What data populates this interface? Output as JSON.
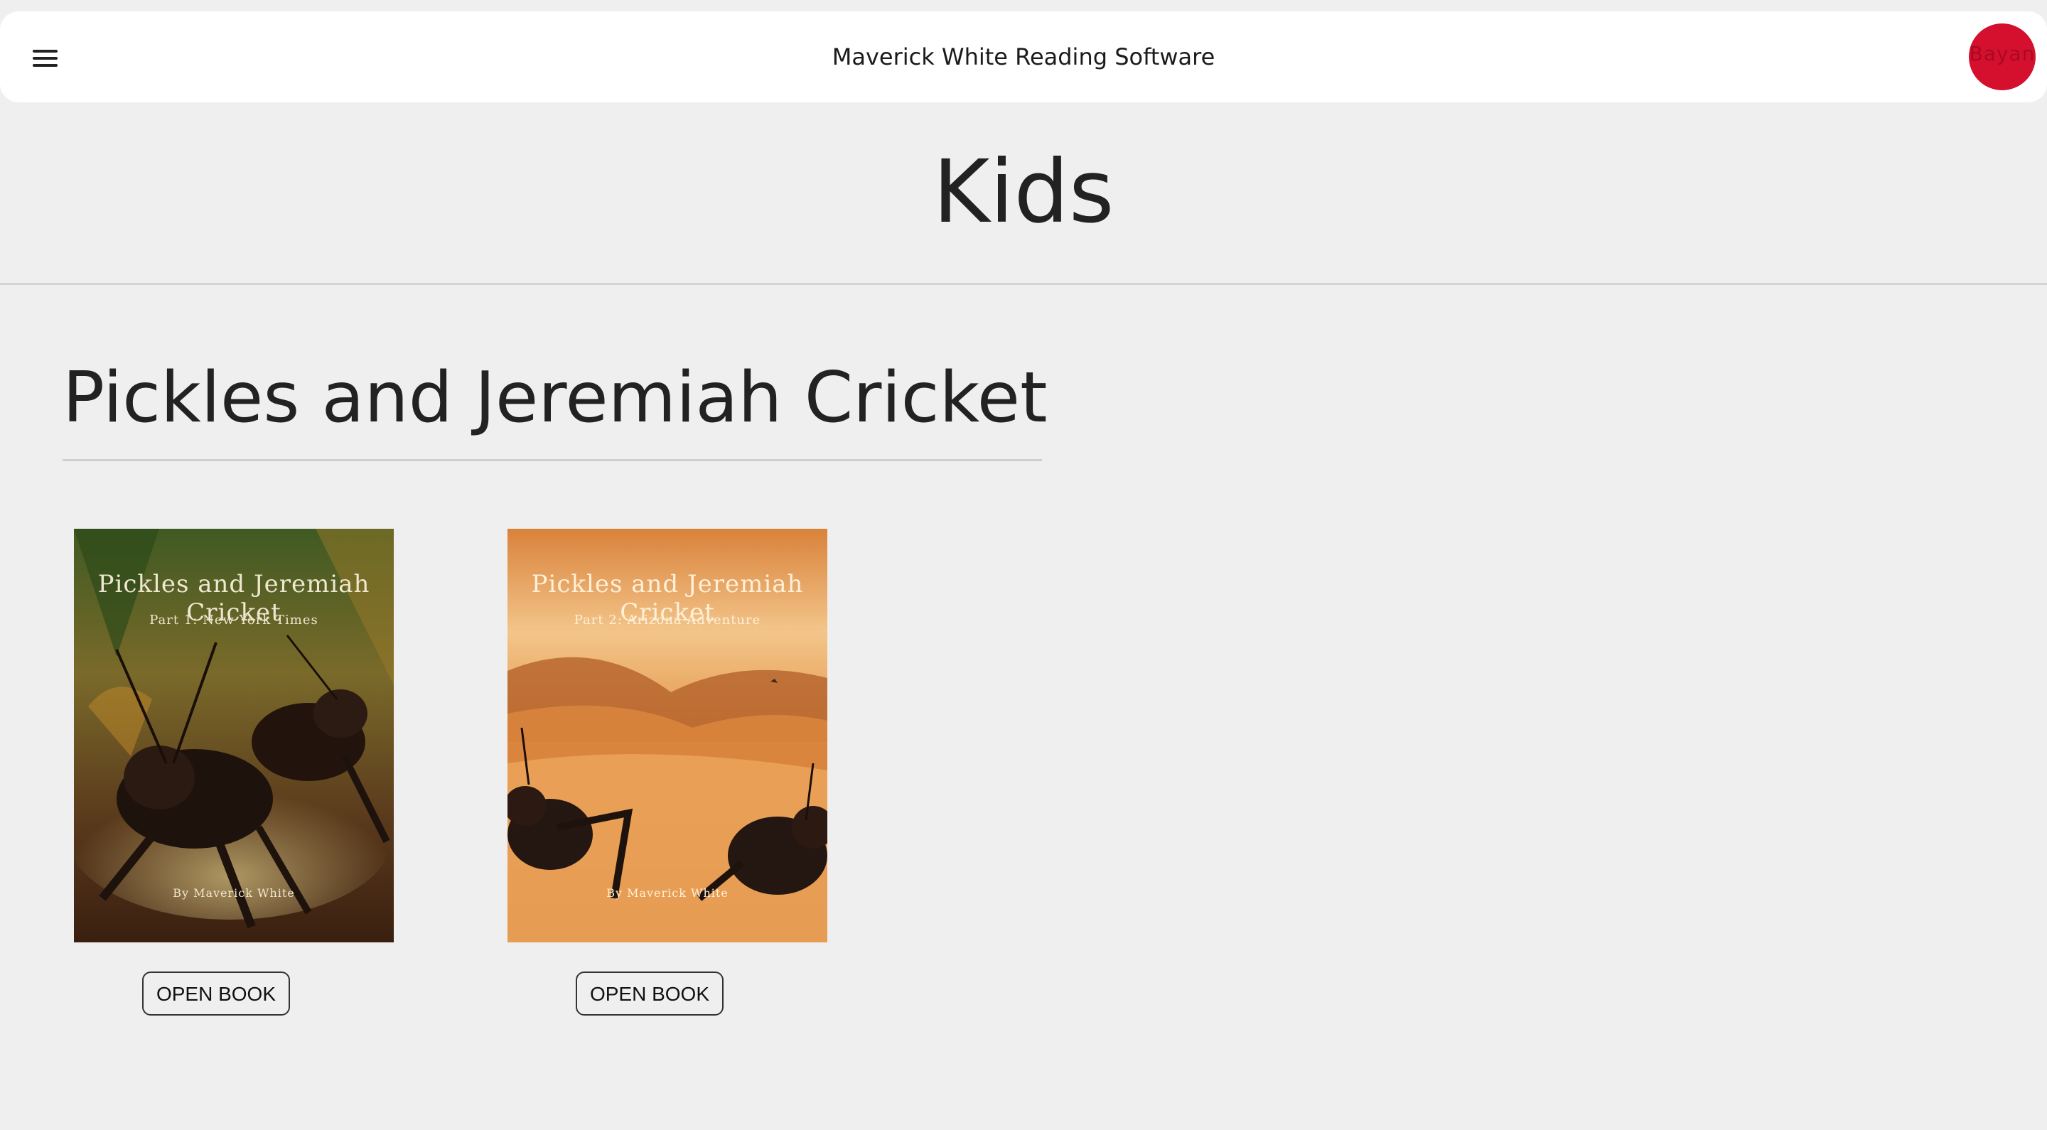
{
  "header": {
    "menu_icon": "hamburger-menu-icon",
    "app_title": "Maverick White Reading Software",
    "avatar_text": "Bayan",
    "avatar_color": "#d50f2e"
  },
  "page": {
    "title": "Kids"
  },
  "section": {
    "title": "Pickles and Jeremiah Cricket",
    "books": [
      {
        "cover_title": "Pickles and Jeremiah Cricket",
        "cover_subtitle": "Part 1: New York Times",
        "cover_author": "By Maverick White",
        "button_label": "OPEN BOOK"
      },
      {
        "cover_title": "Pickles and Jeremiah Cricket",
        "cover_subtitle": "Part 2: Arizona Adventure",
        "cover_author": "By Maverick White",
        "button_label": "OPEN BOOK"
      }
    ]
  }
}
